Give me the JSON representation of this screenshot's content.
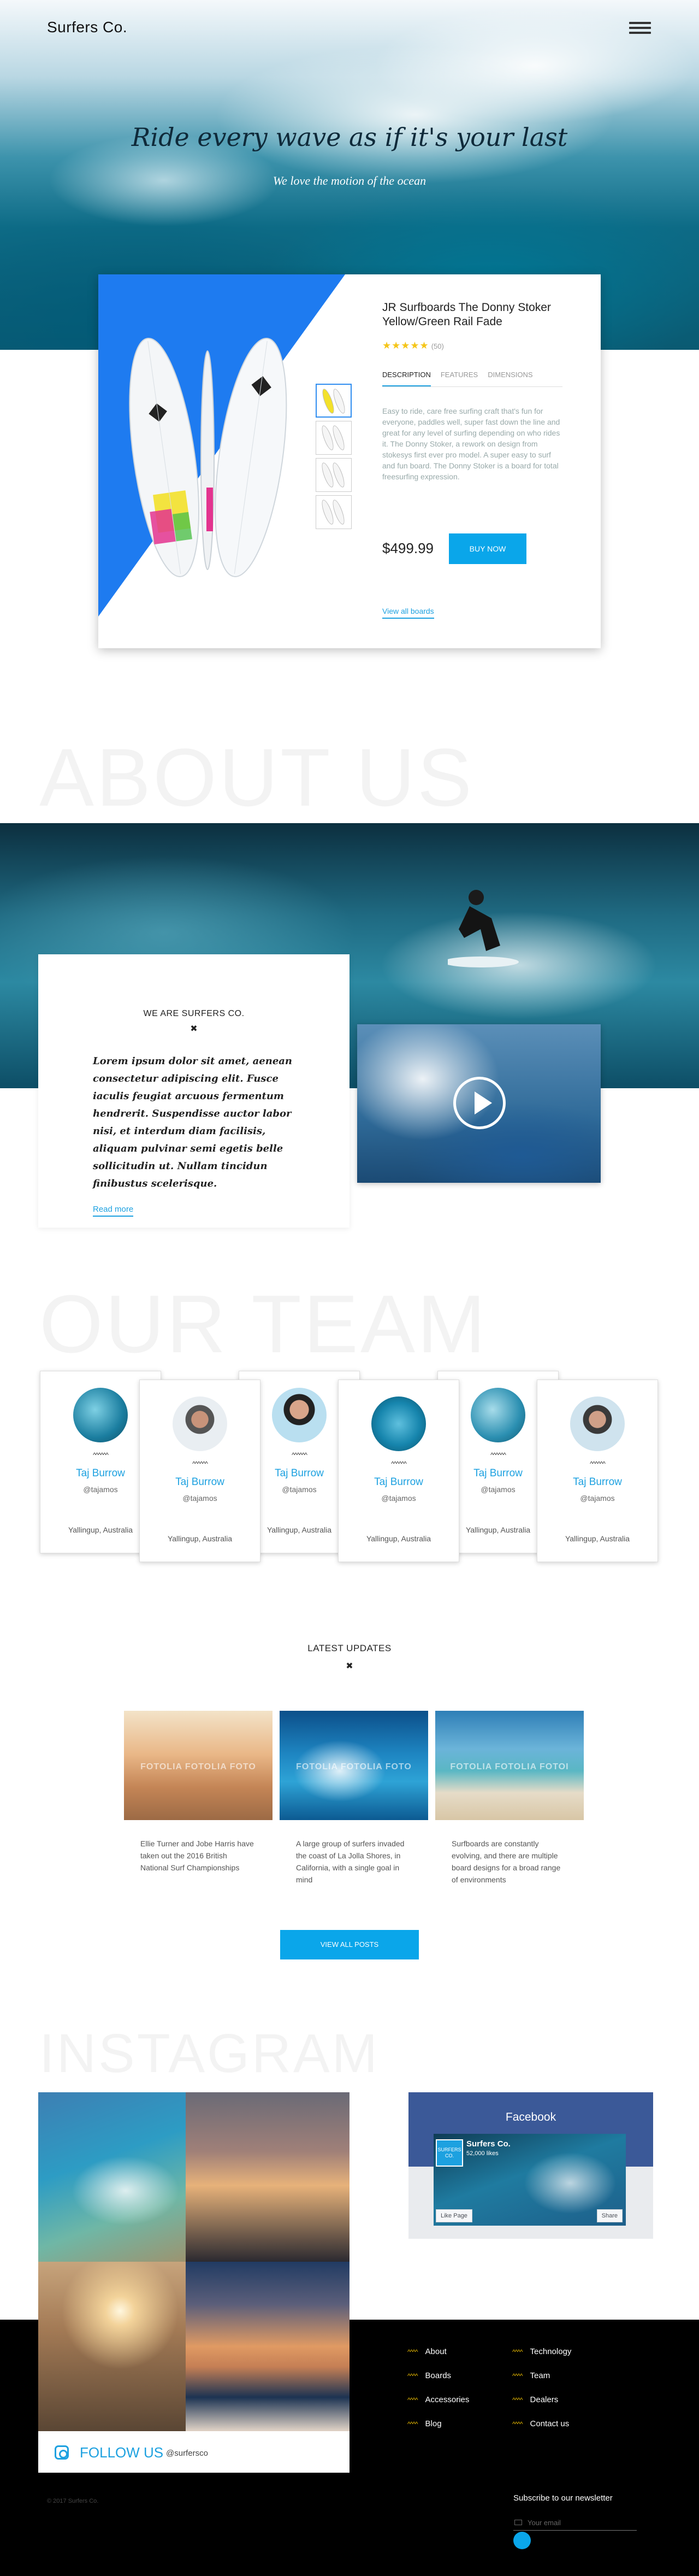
{
  "header": {
    "brand": "Surfers Co.",
    "menu_icon": "hamburger-icon"
  },
  "hero": {
    "title": "Ride every wave as if it's your last",
    "subtitle": "We love the motion of the ocean"
  },
  "product": {
    "title": "JR Surfboards The Donny Stoker Yellow/Green Rail Fade",
    "stars": "★★★★★",
    "rating": 5,
    "review_count": "(50)",
    "tabs": [
      "DESCRIPTION",
      "FEATURES",
      "DIMENSIONS"
    ],
    "description": "Easy to ride, care free surfing craft that's fun for everyone, paddles well, super fast down the line and great for any level of surfing depending on who rides it. The Donny Stoker, a rework on design from stokesys first ever pro model. A super easy to surf and fun board. The Donny Stoker is a board for total freesurfing expression.",
    "price": "$499.99",
    "buy_label": "BUY NOW",
    "view_all_label": "View all boards",
    "accent": "#1e7bf0"
  },
  "about": {
    "big_heading": "ABOUT US",
    "label": "WE ARE SURFERS CO.",
    "mark": "✖",
    "text": "Lorem ipsum dolor sit amet, aenean consectetur adipiscing elit. Fusce iaculis feugiat arcuous fermentum hendrerit. Suspendisse auctor labor nisi, et interdum diam facilisis, aliquam pulvinar semi egetis belle sollicitudin ut. Nullam tincidun finibustus scelerisque.",
    "read_more": "Read more"
  },
  "team": {
    "big_heading": "OUR TEAM",
    "members": [
      {
        "name": "Taj Burrow",
        "handle": "@tajamos",
        "location": "Yallingup, Australia",
        "squiggle": "^^^^^^"
      },
      {
        "name": "Taj Burrow",
        "handle": "@tajamos",
        "location": "Yallingup, Australia",
        "squiggle": "^^^^^^"
      },
      {
        "name": "Taj Burrow",
        "handle": "@tajamos",
        "location": "Yallingup, Australia",
        "squiggle": "^^^^^^"
      },
      {
        "name": "Taj Burrow",
        "handle": "@tajamos",
        "location": "Yallingup, Australia",
        "squiggle": "^^^^^^"
      },
      {
        "name": "Taj Burrow",
        "handle": "@tajamos",
        "location": "Yallingup, Australia",
        "squiggle": "^^^^^^"
      },
      {
        "name": "Taj Burrow",
        "handle": "@tajamos",
        "location": "Yallingup, Australia",
        "squiggle": "^^^^^^"
      }
    ]
  },
  "updates": {
    "label": "LATEST UPDATES",
    "mark": "✖",
    "posts": [
      {
        "watermark": "FOTOLIA FOTOLIA FOTO",
        "text": "Ellie Turner and Jobe Harris have taken out the 2016 British National Surf Championships"
      },
      {
        "watermark": "FOTOLIA FOTOLIA FOTO",
        "text": "A large group of surfers invaded the coast of La Jolla Shores, in California, with a single goal in mind"
      },
      {
        "watermark": "FOTOLIA FOTOLIA FOTOI",
        "text": "Surfboards are constantly evolving, and there are multiple board designs for a broad range of environments"
      }
    ],
    "view_all": "VIEW ALL POSTS"
  },
  "instagram": {
    "big_heading": "INSTAGRAM",
    "follow_label": "FOLLOW US",
    "handle": "@surfersco",
    "icon": "instagram-icon"
  },
  "facebook": {
    "title": "Facebook",
    "page_name": "Surfers Co.",
    "likes": "52,000 likes",
    "logo_text": "SURFERS CO.",
    "like_label": "Like Page",
    "share_label": "Share",
    "brand_color": "#3b5998"
  },
  "footer": {
    "links_left": [
      "About",
      "Boards",
      "Accessories",
      "Blog"
    ],
    "links_right": [
      "Technology",
      "Team",
      "Dealers",
      "Contact us"
    ],
    "zigzag": "^^^^",
    "copyright": "© 2017 Surfers Co.",
    "newsletter_title": "Subscribe to our newsletter",
    "email_placeholder": "Your email"
  }
}
